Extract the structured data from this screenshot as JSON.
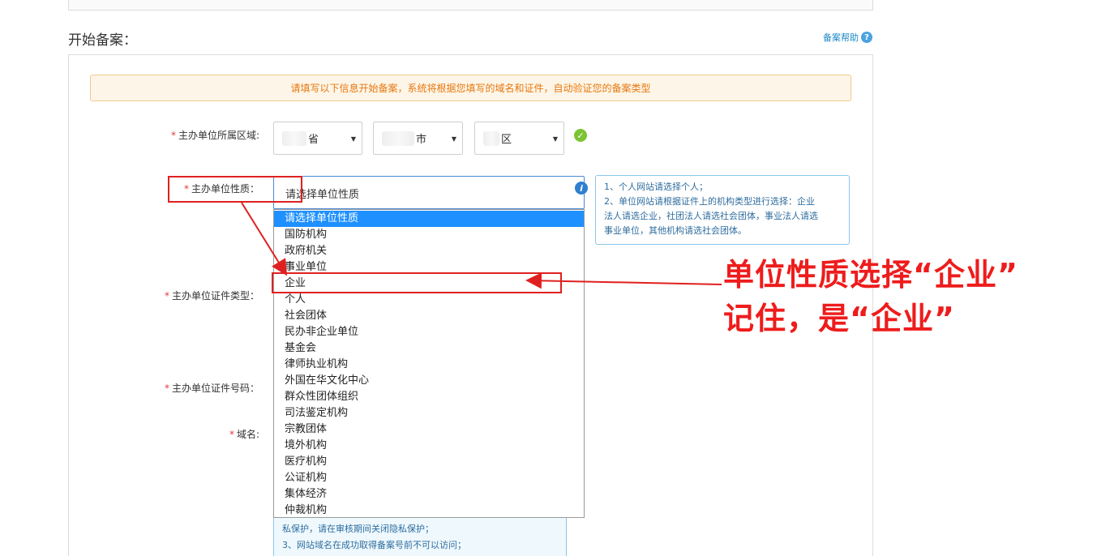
{
  "section_title": "开始备案：",
  "help_link": "备案帮助",
  "notice": "请填写以下信息开始备案，系统将根据您填写的域名和证件，自动验证您的备案类型",
  "labels": {
    "region": "主办单位所属区域:",
    "nature": "主办单位性质：",
    "cert_type": "主办单位证件类型：",
    "cert_no": "主办单位证件号码：",
    "domain": "域名:"
  },
  "region": {
    "province": "省",
    "city": "市",
    "district": "区"
  },
  "nature_select": {
    "value": "请选择单位性质",
    "options": [
      "请选择单位性质",
      "国防机构",
      "政府机关",
      "事业单位",
      "企业",
      "个人",
      "社会团体",
      "民办非企业单位",
      "基金会",
      "律师执业机构",
      "外国在华文化中心",
      "群众性团体组织",
      "司法鉴定机构",
      "宗教团体",
      "境外机构",
      "医疗机构",
      "公证机构",
      "集体经济",
      "仲裁机构"
    ]
  },
  "tip": {
    "lines": [
      "1、个人网站请选择个人；",
      "2、单位网站请根据证件上的机构类型进行选择：企业",
      "法人请选企业，社团法人请选社会团体，事业法人请选",
      "事业单位，其他机构请选社会团体。"
    ]
  },
  "bottom_tip": {
    "lines": [
      "私保护，请在审核期间关闭隐私保护；",
      "3、网站域名在成功取得备案号前不可以访问；"
    ]
  },
  "annotation": {
    "line1": "单位性质选择“企业”",
    "line2": "记住，是“企业”"
  },
  "colors": {
    "annotation_red": "#ee1c1c",
    "selected_blue": "#1e90ff",
    "notice_orange": "#e8770f"
  }
}
